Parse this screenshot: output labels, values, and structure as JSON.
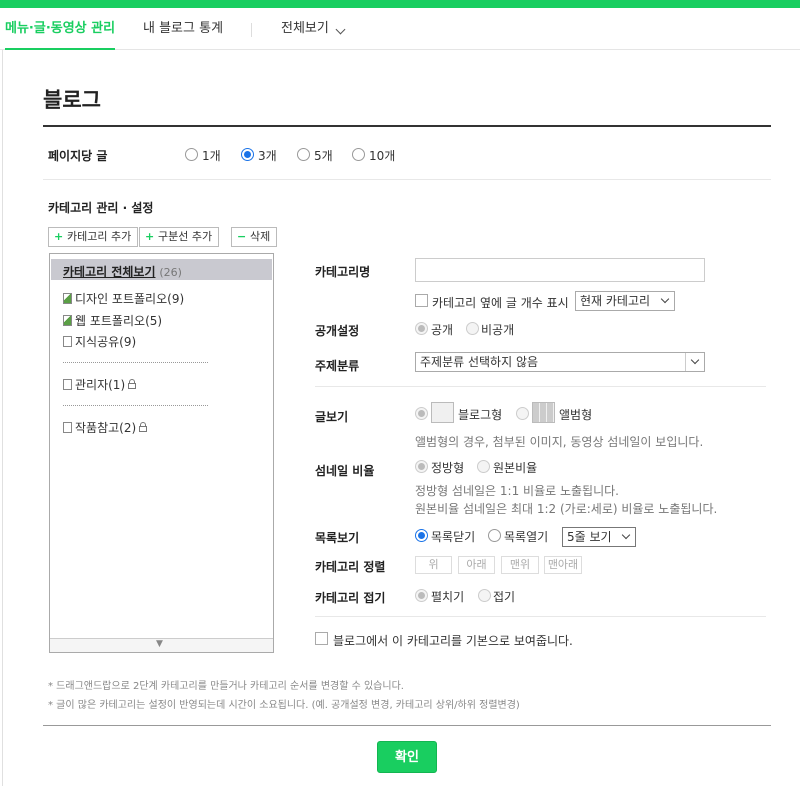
{
  "tabs": [
    {
      "label": "메뉴·글·동영상 관리"
    },
    {
      "label": "내 블로그 통계"
    },
    {
      "label": "전체보기"
    }
  ],
  "page_title": "블로그",
  "posts_per_page": {
    "label": "페이지당 글",
    "options": [
      "1개",
      "3개",
      "5개",
      "10개"
    ],
    "selected": "3개"
  },
  "category_section": {
    "title": "카테고리 관리 · 설정",
    "buttons": {
      "add_category": "카테고리 추가",
      "add_divider": "구분선 추가",
      "delete": "삭제"
    },
    "delete_symbol": "−",
    "plus_symbol": "+",
    "tree": {
      "all_label": "카테고리 전체보기",
      "all_count": "(26)",
      "items": [
        {
          "label": "디자인 포트폴리오",
          "count": "(9)"
        },
        {
          "label": "웹 포트폴리오",
          "count": "(5)"
        },
        {
          "label": "지식공유",
          "count": "(9)"
        },
        {
          "label": "관리자",
          "count": "(1)"
        },
        {
          "label": "작품참고",
          "count": "(2)"
        }
      ],
      "scroll_symbol": "▼"
    }
  },
  "settings": {
    "name_label": "카테고리명",
    "show_count_label": "카테고리 옆에 글 개수 표시",
    "count_select": "현재 카테고리",
    "visibility_label": "공개설정",
    "visibility_options": [
      "공개",
      "비공개"
    ],
    "topic_label": "주제분류",
    "topic_select": "주제분류 선택하지 않음",
    "view_label": "글보기",
    "view_options": [
      "블로그형",
      "앨범형"
    ],
    "view_note": "앨범형의 경우, 첨부된 이미지, 동영상 섬네일이 보입니다.",
    "thumb_label": "섬네일 비율",
    "thumb_options": [
      "정방형",
      "원본비율"
    ],
    "thumb_note1": "정방형 섬네일은 1:1 비율로 노출됩니다.",
    "thumb_note2": "원본비율 섬네일은 최대 1:2 (가로:세로) 비율로 노출됩니다.",
    "list_label": "목록보기",
    "list_options": [
      "목록닫기",
      "목록열기"
    ],
    "list_select": "5줄 보기",
    "sort_label": "카테고리 정렬",
    "sort_buttons": [
      "위",
      "아래",
      "맨위",
      "맨아래"
    ],
    "fold_label": "카테고리 접기",
    "fold_options": [
      "펼치기",
      "접기"
    ],
    "default_label": "블로그에서 이 카테고리를 기본으로 보여줍니다."
  },
  "footnotes": [
    "* 드래그앤드랍으로 2단계 카테고리를 만들거나 카테고리 순서를 변경할 수 있습니다.",
    "* 글이 많은 카테고리는 설정이 반영되는데 시간이 소요됩니다. (예. 공개설정 변경, 카테고리 상위/하위 정렬변경)"
  ],
  "confirm_label": "확인",
  "colors": {
    "accent": "#19ce60",
    "radio_on": "#1a73e8"
  }
}
